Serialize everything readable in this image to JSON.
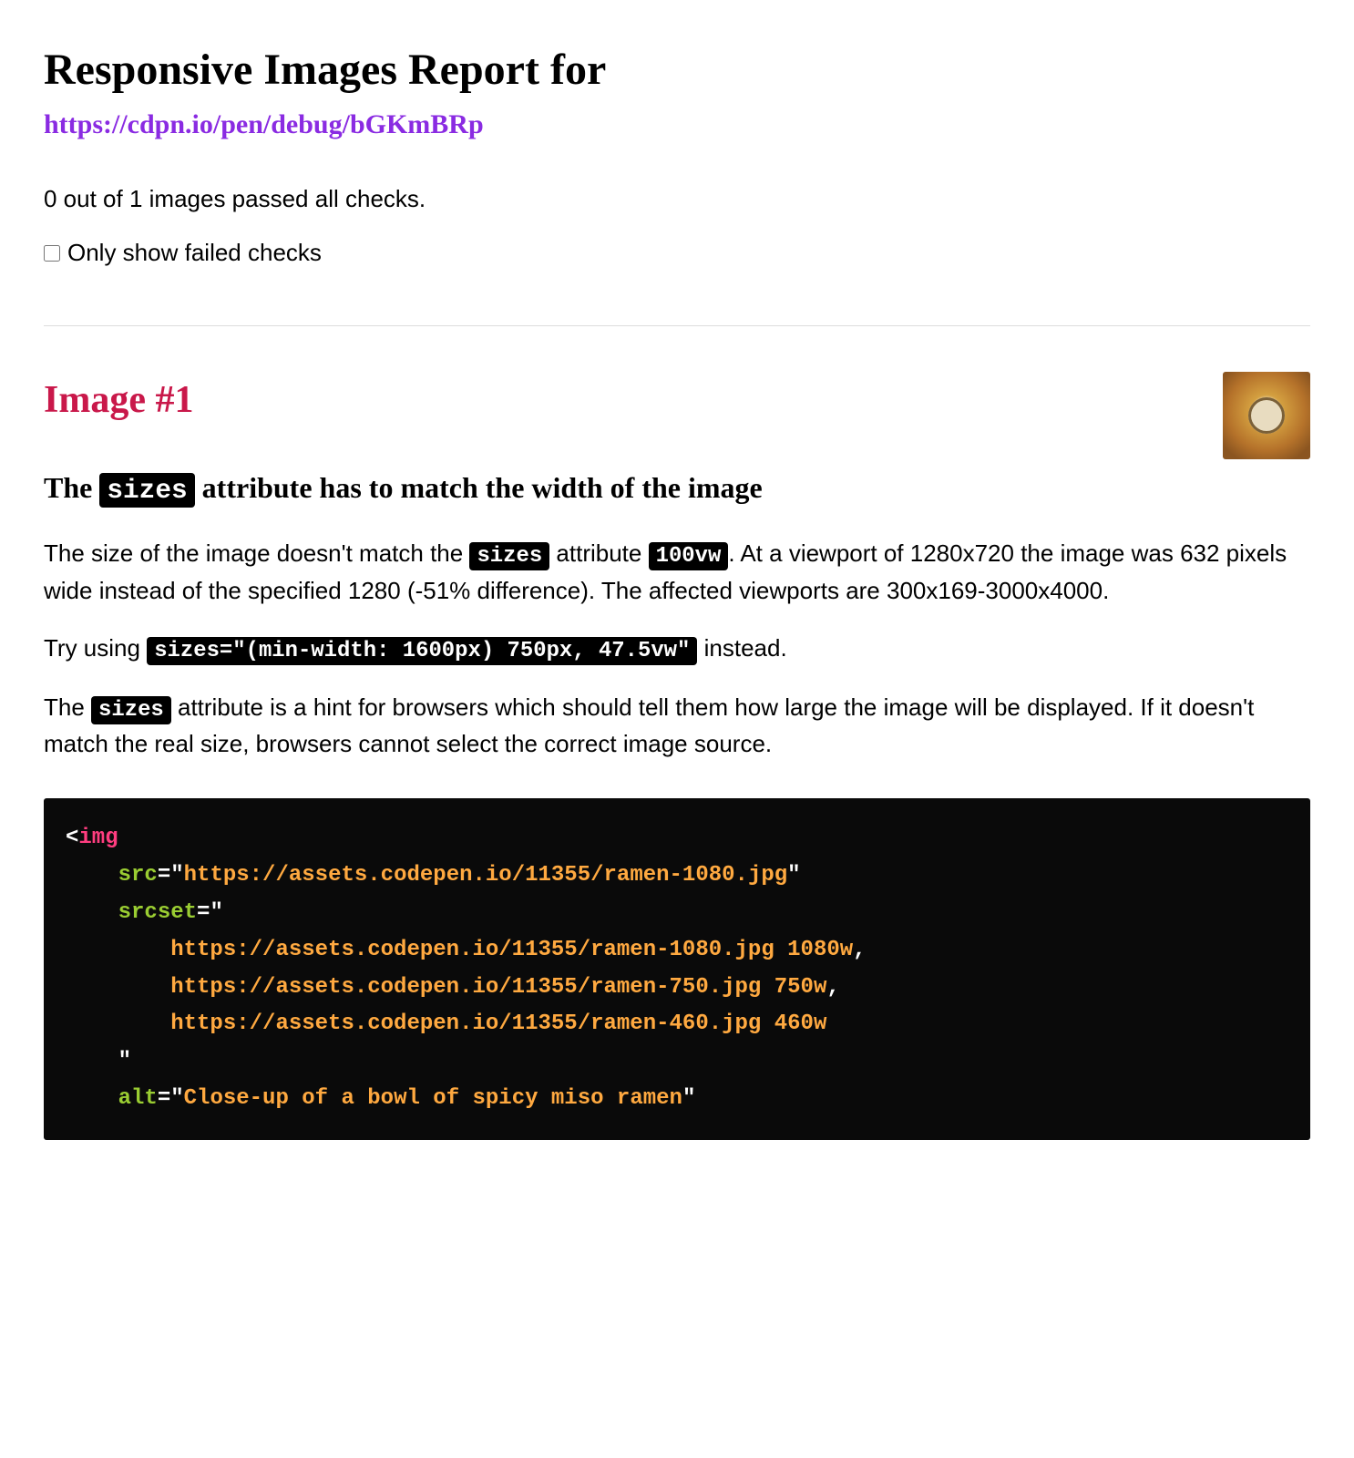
{
  "header": {
    "title": "Responsive Images Report for",
    "url": "https://cdpn.io/pen/debug/bGKmBRp"
  },
  "summary": {
    "passed_text": "0 out of 1 images passed all checks.",
    "filter_label": "Only show failed checks",
    "filter_checked": false
  },
  "image1": {
    "heading": "Image #1",
    "check_heading_pre": "The ",
    "check_heading_code": "sizes",
    "check_heading_post": " attribute has to match the width of the image",
    "p1_pre": "The size of the image doesn't match the ",
    "p1_code1": "sizes",
    "p1_mid1": " attribute ",
    "p1_code2": "100vw",
    "p1_post": ". At a viewport of 1280x720 the image was 632 pixels wide instead of the specified 1280 (-51% difference). The affected viewports are 300x169-3000x4000.",
    "p2_pre": "Try using ",
    "p2_code": "sizes=\"(min-width: 1600px) 750px, 47.5vw\"",
    "p2_post": " instead.",
    "p3_pre": "The ",
    "p3_code": "sizes",
    "p3_post": " attribute is a hint for browsers which should tell them how large the image will be displayed. If it doesn't match the real size, browsers cannot select the correct image source.",
    "code": {
      "tag": "img",
      "attr_src": "src",
      "val_src": "https://assets.codepen.io/11355/ramen-1080.jpg",
      "attr_srcset": "srcset",
      "srcset_items": [
        {
          "url": "https://assets.codepen.io/11355/ramen-1080.jpg",
          "width": "1080w",
          "comma": ","
        },
        {
          "url": "https://assets.codepen.io/11355/ramen-750.jpg",
          "width": "750w",
          "comma": ","
        },
        {
          "url": "https://assets.codepen.io/11355/ramen-460.jpg",
          "width": "460w",
          "comma": ""
        }
      ],
      "attr_alt": "alt",
      "val_alt": "Close-up of a bowl of spicy miso ramen"
    }
  }
}
